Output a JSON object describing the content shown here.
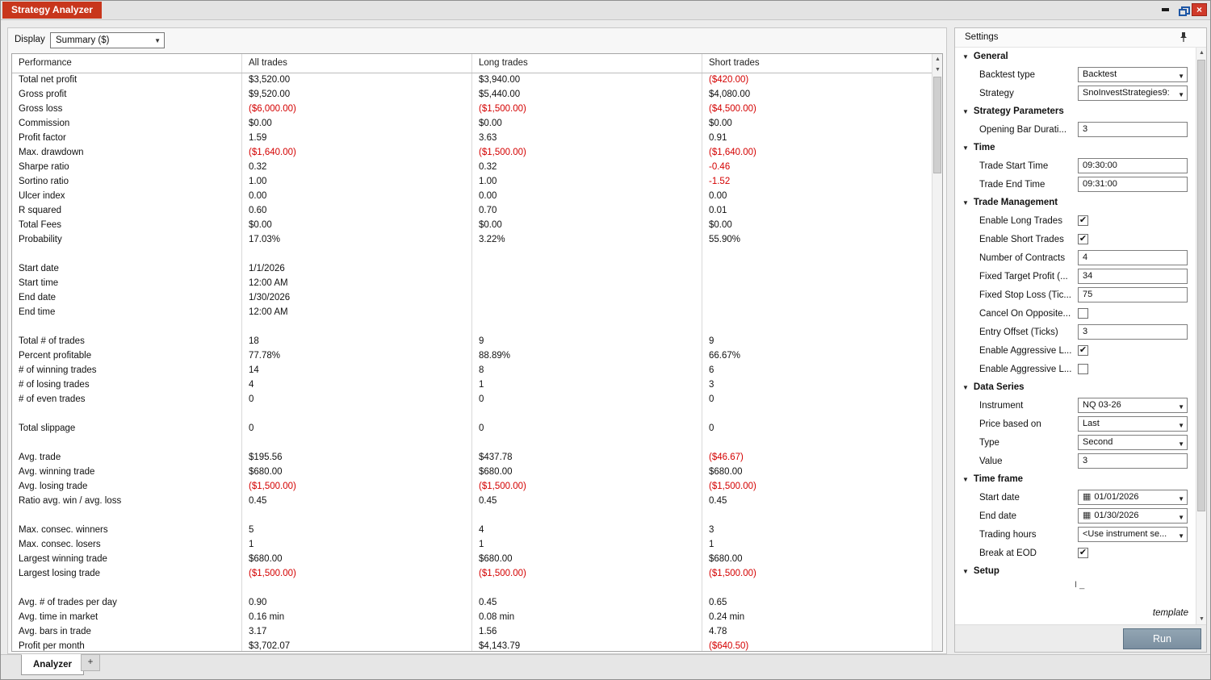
{
  "window": {
    "title": "Strategy Analyzer"
  },
  "toolbar": {
    "display_label": "Display",
    "display_value": "Summary ($)"
  },
  "icons": {
    "caret_down": "▼",
    "scroll_up": "▲",
    "scroll_down": "▼",
    "check": "✔",
    "calendar": "▦",
    "close": "×",
    "plus": "+",
    "section_triangle": "▼"
  },
  "colors": {
    "title_tab_bg": "#c8361c",
    "negative": "#d40000",
    "run_bg": "#8396a6"
  },
  "table": {
    "columns": [
      "Performance",
      "All trades",
      "Long trades",
      "Short trades"
    ],
    "rows": [
      {
        "label": "Total net profit",
        "values": [
          "$3,520.00",
          "$3,940.00",
          "($420.00)"
        ]
      },
      {
        "label": "Gross profit",
        "values": [
          "$9,520.00",
          "$5,440.00",
          "$4,080.00"
        ]
      },
      {
        "label": "Gross loss",
        "values": [
          "($6,000.00)",
          "($1,500.00)",
          "($4,500.00)"
        ]
      },
      {
        "label": "Commission",
        "values": [
          "$0.00",
          "$0.00",
          "$0.00"
        ]
      },
      {
        "label": "Profit factor",
        "values": [
          "1.59",
          "3.63",
          "0.91"
        ]
      },
      {
        "label": "Max. drawdown",
        "values": [
          "($1,640.00)",
          "($1,500.00)",
          "($1,640.00)"
        ]
      },
      {
        "label": "Sharpe ratio",
        "values": [
          "0.32",
          "0.32",
          "-0.46"
        ]
      },
      {
        "label": "Sortino ratio",
        "values": [
          "1.00",
          "1.00",
          "-1.52"
        ]
      },
      {
        "label": "Ulcer index",
        "values": [
          "0.00",
          "0.00",
          "0.00"
        ]
      },
      {
        "label": "R squared",
        "values": [
          "0.60",
          "0.70",
          "0.01"
        ]
      },
      {
        "label": "Total Fees",
        "values": [
          "$0.00",
          "$0.00",
          "$0.00"
        ]
      },
      {
        "label": "Probability",
        "values": [
          "17.03%",
          "3.22%",
          "55.90%"
        ]
      },
      {
        "spacer": true
      },
      {
        "label": "Start date",
        "values": [
          "1/1/2026",
          "",
          ""
        ]
      },
      {
        "label": "Start time",
        "values": [
          "12:00 AM",
          "",
          ""
        ]
      },
      {
        "label": "End date",
        "values": [
          "1/30/2026",
          "",
          ""
        ]
      },
      {
        "label": "End time",
        "values": [
          "12:00 AM",
          "",
          ""
        ]
      },
      {
        "spacer": true
      },
      {
        "label": "Total # of trades",
        "values": [
          "18",
          "9",
          "9"
        ]
      },
      {
        "label": "Percent profitable",
        "values": [
          "77.78%",
          "88.89%",
          "66.67%"
        ]
      },
      {
        "label": "# of winning trades",
        "values": [
          "14",
          "8",
          "6"
        ]
      },
      {
        "label": "# of losing trades",
        "values": [
          "4",
          "1",
          "3"
        ]
      },
      {
        "label": "# of even trades",
        "values": [
          "0",
          "0",
          "0"
        ]
      },
      {
        "spacer": true
      },
      {
        "label": "Total slippage",
        "values": [
          "0",
          "0",
          "0"
        ]
      },
      {
        "spacer": true
      },
      {
        "label": "Avg. trade",
        "values": [
          "$195.56",
          "$437.78",
          "($46.67)"
        ]
      },
      {
        "label": "Avg. winning trade",
        "values": [
          "$680.00",
          "$680.00",
          "$680.00"
        ]
      },
      {
        "label": "Avg. losing trade",
        "values": [
          "($1,500.00)",
          "($1,500.00)",
          "($1,500.00)"
        ]
      },
      {
        "label": "Ratio avg. win / avg. loss",
        "values": [
          "0.45",
          "0.45",
          "0.45"
        ]
      },
      {
        "spacer": true
      },
      {
        "label": "Max. consec. winners",
        "values": [
          "5",
          "4",
          "3"
        ]
      },
      {
        "label": "Max. consec. losers",
        "values": [
          "1",
          "1",
          "1"
        ]
      },
      {
        "label": "Largest winning trade",
        "values": [
          "$680.00",
          "$680.00",
          "$680.00"
        ]
      },
      {
        "label": "Largest losing trade",
        "values": [
          "($1,500.00)",
          "($1,500.00)",
          "($1,500.00)"
        ]
      },
      {
        "spacer": true
      },
      {
        "label": "Avg. # of trades per day",
        "values": [
          "0.90",
          "0.45",
          "0.65"
        ]
      },
      {
        "label": "Avg. time in market",
        "values": [
          "0.16 min",
          "0.08 min",
          "0.24 min"
        ]
      },
      {
        "label": "Avg. bars in trade",
        "values": [
          "3.17",
          "1.56",
          "4.78"
        ]
      },
      {
        "label": "Profit per month",
        "values": [
          "$3,702.07",
          "$4,143.79",
          "($640.50)"
        ]
      }
    ]
  },
  "settings": {
    "title": "Settings",
    "template_label": "template",
    "run_label": "Run",
    "partial_text": "I _",
    "sections": [
      {
        "label": "General",
        "rows": [
          {
            "label": "Backtest type",
            "type": "select",
            "value": "Backtest"
          },
          {
            "label": "Strategy",
            "type": "select",
            "value": "SnoInvestStrategies9:"
          }
        ]
      },
      {
        "label": "Strategy Parameters",
        "rows": [
          {
            "label": "Opening Bar Durati...",
            "type": "input",
            "value": "3"
          }
        ]
      },
      {
        "label": "Time",
        "rows": [
          {
            "label": "Trade Start Time",
            "type": "input",
            "value": "09:30:00"
          },
          {
            "label": "Trade End Time",
            "type": "input",
            "value": "09:31:00"
          }
        ]
      },
      {
        "label": "Trade Management",
        "rows": [
          {
            "label": "Enable Long Trades",
            "type": "checkbox",
            "checked": true
          },
          {
            "label": "Enable Short Trades",
            "type": "checkbox",
            "checked": true
          },
          {
            "label": "Number of Contracts",
            "type": "input",
            "value": "4"
          },
          {
            "label": "Fixed Target Profit (...",
            "type": "input",
            "value": "34"
          },
          {
            "label": "Fixed Stop Loss (Tic...",
            "type": "input",
            "value": "75"
          },
          {
            "label": "Cancel On Opposite...",
            "type": "checkbox",
            "checked": false
          },
          {
            "label": "Entry Offset (Ticks)",
            "type": "input",
            "value": "3"
          },
          {
            "label": "Enable Aggressive L...",
            "type": "checkbox",
            "checked": true
          },
          {
            "label": "Enable Aggressive L...",
            "type": "checkbox",
            "checked": false
          }
        ]
      },
      {
        "label": "Data Series",
        "rows": [
          {
            "label": "Instrument",
            "type": "select",
            "value": "NQ 03-26"
          },
          {
            "label": "Price based on",
            "type": "select",
            "value": "Last"
          },
          {
            "label": "Type",
            "type": "select",
            "value": "Second"
          },
          {
            "label": "Value",
            "type": "input",
            "value": "3"
          }
        ]
      },
      {
        "label": "Time frame",
        "rows": [
          {
            "label": "Start date",
            "type": "date",
            "value": "01/01/2026"
          },
          {
            "label": "End date",
            "type": "date",
            "value": "01/30/2026"
          },
          {
            "label": "Trading hours",
            "type": "select",
            "value": "<Use instrument se..."
          },
          {
            "label": "Break at EOD",
            "type": "checkbox",
            "checked": true
          }
        ]
      },
      {
        "label": "Setup",
        "rows": []
      }
    ]
  },
  "tabs": {
    "analyzer": "Analyzer",
    "add": "+"
  }
}
